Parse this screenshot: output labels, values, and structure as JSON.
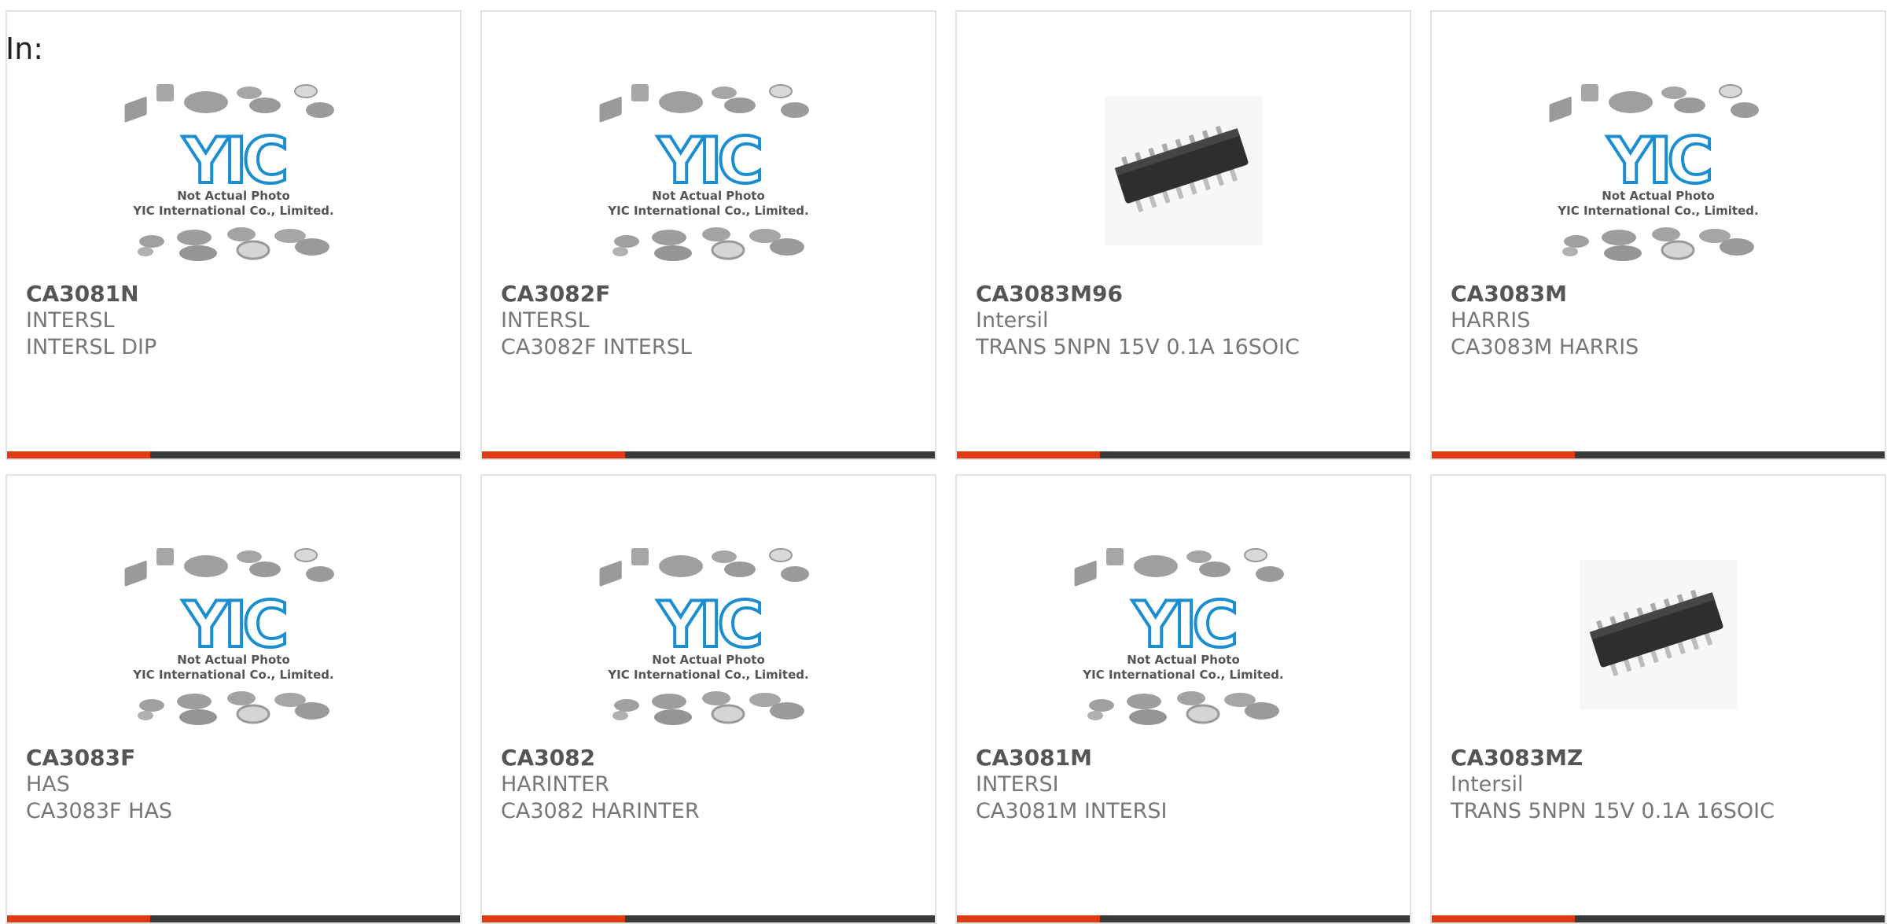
{
  "page": {
    "label": "In:"
  },
  "colors": {
    "accent": "#e03a12",
    "bar": "#3a3a3a",
    "logo": "#1a8ed0"
  },
  "products": [
    {
      "part": "CA3081N",
      "manufacturer": "INTERSL",
      "description": "INTERSL DIP",
      "image": "placeholder"
    },
    {
      "part": "CA3082F",
      "manufacturer": "INTERSL",
      "description": "CA3082F INTERSL",
      "image": "placeholder"
    },
    {
      "part": "CA3083M96",
      "manufacturer": "Intersil",
      "description": "TRANS 5NPN 15V 0.1A 16SOIC",
      "image": "soic-chip"
    },
    {
      "part": "CA3083M",
      "manufacturer": "HARRIS",
      "description": "CA3083M HARRIS",
      "image": "placeholder"
    },
    {
      "part": "CA3083F",
      "manufacturer": "HAS",
      "description": "CA3083F HAS",
      "image": "placeholder"
    },
    {
      "part": "CA3082",
      "manufacturer": "HARINTER",
      "description": "CA3082 HARINTER",
      "image": "placeholder"
    },
    {
      "part": "CA3081M",
      "manufacturer": "INTERSI",
      "description": "CA3081M INTERSI",
      "image": "placeholder"
    },
    {
      "part": "CA3083MZ",
      "manufacturer": "Intersil",
      "description": "TRANS 5NPN 15V 0.1A 16SOIC",
      "image": "soic-chip"
    }
  ],
  "placeholder": {
    "logo_text": "YIC",
    "line1": "Not Actual Photo",
    "line2": "YIC International Co., Limited."
  }
}
